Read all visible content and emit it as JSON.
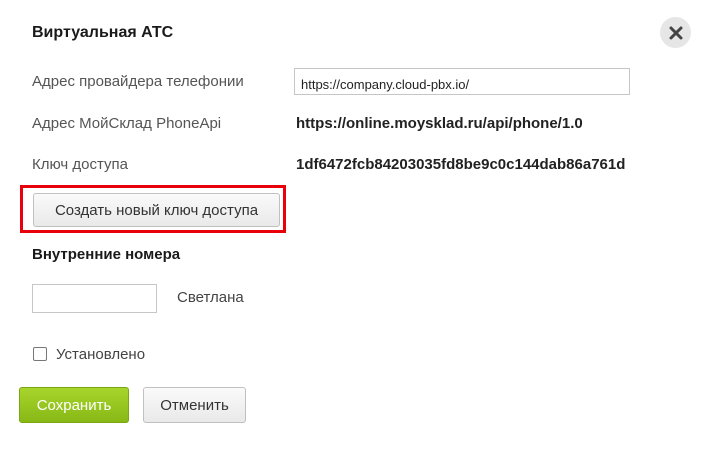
{
  "dialog": {
    "title": "Виртуальная АТС",
    "close_icon": "close-icon"
  },
  "form": {
    "provider_address": {
      "label": "Адрес провайдера телефонии",
      "value": "https://company.cloud-pbx.io/"
    },
    "phone_api_address": {
      "label": "Адрес МойСклад PhoneApi",
      "value": "https://online.moysklad.ru/api/phone/1.0"
    },
    "access_key": {
      "label": "Ключ доступа",
      "value": "1df6472fcb84203035fd8be9c0c144dab86a761d"
    },
    "generate_key_label": "Создать новый ключ доступа"
  },
  "extensions": {
    "section_title": "Внутренние номера",
    "items": [
      {
        "number": "",
        "name": "Светлана"
      }
    ]
  },
  "installed": {
    "label": "Установлено",
    "checked": false
  },
  "actions": {
    "save_label": "Сохранить",
    "cancel_label": "Отменить"
  },
  "colors": {
    "highlight": "#e8000b",
    "save_button": "#95c41f"
  }
}
